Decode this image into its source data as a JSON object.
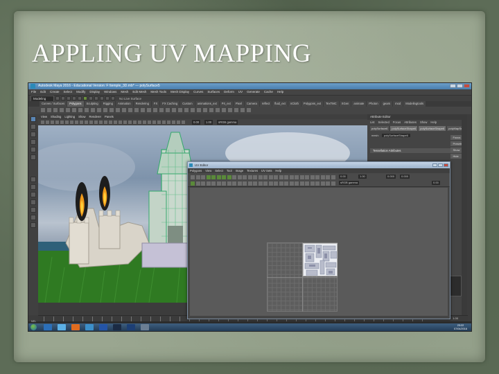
{
  "slide": {
    "title": "APPLING UV MAPPING"
  },
  "maya": {
    "window_title": "Autodesk Maya 2016 - Educational Version: F:\\temple_3D.mb* --- polySurface5",
    "menus": [
      "File",
      "Edit",
      "Create",
      "Select",
      "Modify",
      "Display",
      "Windows",
      "Mesh",
      "Edit Mesh",
      "Mesh Tools",
      "Mesh Display",
      "Curves",
      "Surfaces",
      "Deform",
      "UV",
      "Generate",
      "Cache",
      "Help"
    ],
    "mode": "Modeling",
    "live_surface": "No Live Surface",
    "shelf_tabs": [
      "Curves / Surfaces",
      "Polygons",
      "Sculpting",
      "Rigging",
      "Animation",
      "Rendering",
      "FX",
      "FX Caching",
      "Custom",
      "animations_ext",
      "P4_ext",
      "Pixel",
      "Camera",
      "reflect",
      "fluid_ext",
      "nCloth",
      "Polygons_ext",
      "TexTMC",
      "XGen",
      "animate",
      "Photon",
      "gears",
      "mod",
      "Modelingtools"
    ],
    "active_shelf_tab": "Polygons",
    "viewport_menu": [
      "View",
      "Shading",
      "Lighting",
      "Show",
      "Renderer",
      "Panels"
    ],
    "viewport_fields": {
      "near": "0.00",
      "far": "1.00",
      "color_space": "sRGB gamma"
    },
    "right_panel": {
      "title": "Attribute Editor",
      "menu": [
        "List",
        "Selected",
        "Focus",
        "Attributes",
        "Show",
        "Help"
      ],
      "tabs": [
        "polySurface6",
        "polySurfaceShape6",
        "polySurfaceShape6",
        "polyMapSew"
      ],
      "active_tab": "polySurfaceShape6",
      "mesh_label": "mesh:",
      "mesh_value": "polySurfaceShape6",
      "buttons": [
        "Focus",
        "Presets",
        "Show",
        "Hide"
      ],
      "section": "Tessellation Attributes"
    },
    "timeline": {
      "frame_end": "120",
      "range_end": "1.00"
    },
    "mel_label": "MEL",
    "clock": {
      "time": "23:22",
      "date": "07/04/2016"
    }
  },
  "uv_editor": {
    "title": "UV Editor",
    "menus": [
      "Polygons",
      "View",
      "Select",
      "Tool",
      "Image",
      "Textures",
      "UV Sets",
      "Help"
    ],
    "fields": {
      "a": "0.00",
      "b": "1.00",
      "c": "0.000",
      "d": "0.000",
      "e": "0.00",
      "color_space": "sRGB gamma"
    }
  },
  "colors": {
    "title_text": "#ffffff",
    "maya_bg": "#444444",
    "selected_blue": "#5a86b5",
    "ui_green": "#5a8a3a"
  }
}
